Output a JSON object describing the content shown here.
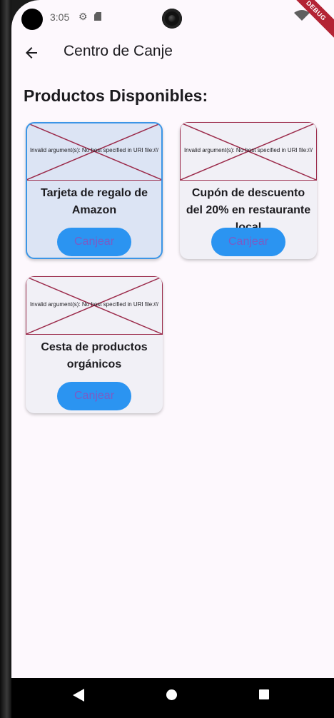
{
  "status_bar": {
    "time": "3:05",
    "debug_label": "DEBUG"
  },
  "app_bar": {
    "title": "Centro de Canje"
  },
  "section_title": "Productos Disponibles:",
  "products": [
    {
      "name": "Tarjeta de regalo de Amazon",
      "image_error": "Invalid argument(s): No host specified in URI file:///",
      "button_label": "Canjear",
      "selected": true
    },
    {
      "name": "Cupón de descuento del 20% en restaurante local",
      "image_error": "Invalid argument(s): No host specified in URI file:///",
      "button_label": "Canjear",
      "selected": false
    },
    {
      "name": "Cesta de productos orgánicos",
      "image_error": "Invalid argument(s): No host specified in URI file:///",
      "button_label": "Canjear",
      "selected": false
    }
  ],
  "colors": {
    "accent_button": "#2b94f1",
    "button_text": "#7b5cc4",
    "selected_border": "#3b95e6",
    "error_cross": "#9b2a4a"
  },
  "icons": {
    "back": "arrow-back-icon",
    "settings": "gear-icon",
    "sd_card": "sd-card-icon",
    "wifi": "wifi-icon",
    "nav_back": "triangle-back-icon",
    "nav_home": "circle-home-icon",
    "nav_recents": "square-recents-icon"
  }
}
